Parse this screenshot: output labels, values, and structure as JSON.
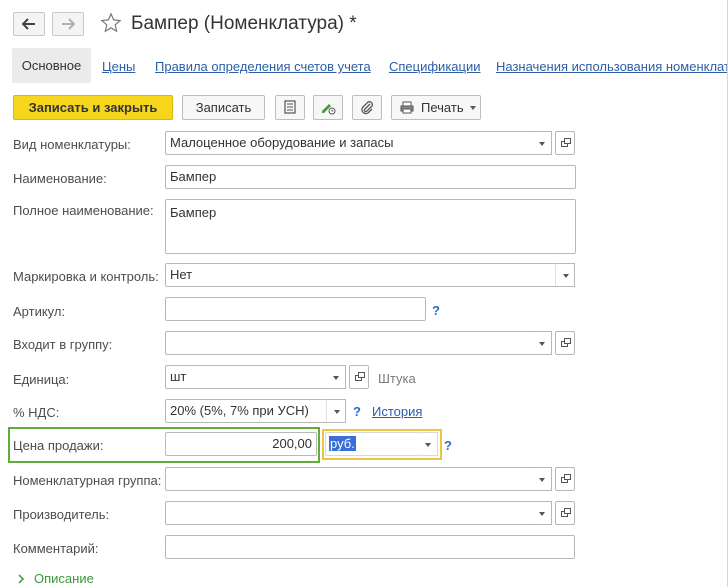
{
  "window": {
    "title": "Бампер (Номенклатура) *"
  },
  "tabs": [
    {
      "label": "Основное"
    },
    {
      "label": "Цены"
    },
    {
      "label": "Правила определения счетов учета"
    },
    {
      "label": "Спецификации"
    },
    {
      "label": "Назначения использования номенклат"
    }
  ],
  "toolbar": {
    "save_close_label": "Записать и закрыть",
    "save_label": "Записать",
    "print_label": "Печать"
  },
  "form": {
    "vid": {
      "label": "Вид номенклатуры:",
      "value": "Малоценное оборудование и запасы"
    },
    "name": {
      "label": "Наименование:",
      "value": "Бампер"
    },
    "full_name": {
      "label": "Полное наименование:",
      "value": "Бампер"
    },
    "marking": {
      "label": "Маркировка и контроль:",
      "value": "Нет"
    },
    "article": {
      "label": "Артикул:",
      "value": "",
      "help": "?"
    },
    "group": {
      "label": "Входит в группу:",
      "value": ""
    },
    "unit": {
      "label": "Единица:",
      "value": "шт",
      "hint": "Штука"
    },
    "vat": {
      "label": "% НДС:",
      "value": "20% (5%, 7% при УСН)",
      "help": "?",
      "history_label": "История"
    },
    "price": {
      "label": "Цена продажи:",
      "value": "200,00",
      "currency": "руб.",
      "help": "?"
    },
    "nom_group": {
      "label": "Номенклатурная группа:",
      "value": ""
    },
    "producer": {
      "label": "Производитель:",
      "value": ""
    },
    "comment": {
      "label": "Комментарий:",
      "value": ""
    },
    "description_label": "Описание"
  },
  "colors": {
    "primary_button": "#f5d61c",
    "link": "#2d5ea8",
    "highlight_green": "#5fae3c",
    "highlight_yellow": "#e8c640",
    "selection": "#3a6fd8"
  }
}
